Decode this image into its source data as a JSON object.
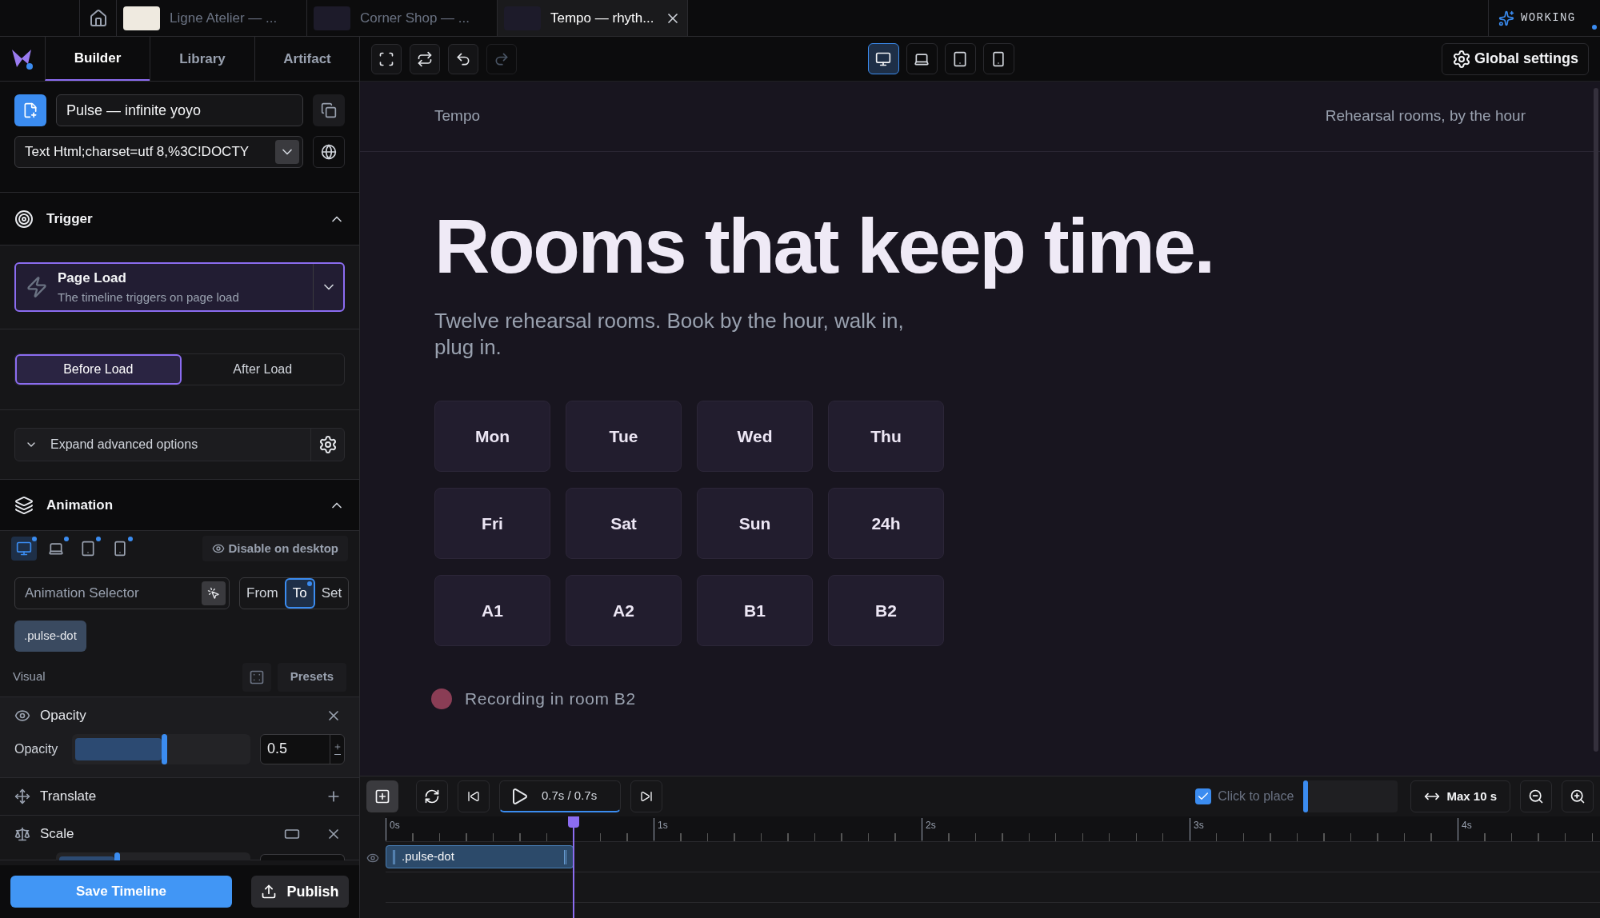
{
  "browser_tabs": [
    {
      "title": "Ligne Atelier — ...",
      "selected": false,
      "color": "#efeae0"
    },
    {
      "title": "Corner Shop — ...",
      "selected": false,
      "color": "#1d1b2a"
    },
    {
      "title": "Tempo — rhyth...",
      "selected": true,
      "color": "#1d1b2a"
    }
  ],
  "status": {
    "label": "WORKING"
  },
  "panel_tabs": [
    {
      "label": "Builder",
      "selected": true
    },
    {
      "label": "Library",
      "selected": false
    },
    {
      "label": "Artifact",
      "selected": false
    }
  ],
  "timeline_name": {
    "value": "Pulse — infinite yoyo"
  },
  "source_url": {
    "value": "Text Html;charset=utf 8,%3C!DOCTY"
  },
  "trigger": {
    "title": "Trigger",
    "expanded": true,
    "event": "Page Load",
    "description": "The timeline triggers on page load",
    "modes": [
      {
        "label": "Before Load",
        "selected": true
      },
      {
        "label": "After Load",
        "selected": false
      }
    ],
    "advanced": "Expand advanced options"
  },
  "animation": {
    "title": "Animation",
    "expanded": true,
    "devices": [
      {
        "kind": "desktop",
        "selected": true
      },
      {
        "kind": "laptop",
        "selected": false
      },
      {
        "kind": "tablet",
        "selected": false
      },
      {
        "kind": "phone",
        "selected": false
      }
    ],
    "disable_label": "Disable on desktop",
    "selector_placeholder": "Animation Selector",
    "directions": [
      {
        "label": "From",
        "selected": false
      },
      {
        "label": "To",
        "selected": true
      },
      {
        "label": "Set",
        "selected": false
      }
    ],
    "selectors": [
      ".pulse-dot"
    ],
    "visual_label": "Visual",
    "presets_label": "Presets",
    "properties": [
      {
        "kind": "slider",
        "title": "Opacity",
        "field_label": "Opacity",
        "level": 0.5,
        "value": "0.5"
      },
      {
        "kind": "header",
        "title": "Translate"
      },
      {
        "kind": "slider",
        "title": "Scale",
        "level": 0.3
      }
    ]
  },
  "actions": {
    "save": "Save Timeline",
    "publish": "Publish"
  },
  "toolbar": {
    "devices": [
      {
        "kind": "desktop",
        "selected": true
      },
      {
        "kind": "laptop",
        "selected": false
      },
      {
        "kind": "tablet",
        "selected": false
      },
      {
        "kind": "phone",
        "selected": false
      }
    ],
    "global_settings": "Global settings"
  },
  "preview": {
    "brand": "Tempo",
    "tagline": "Rehearsal rooms, by the hour",
    "headline": "Rooms that keep time.",
    "subtitle": "Twelve rehearsal rooms. Book by the hour, walk in, plug in.",
    "slots": [
      "Mon",
      "Tue",
      "Wed",
      "Thu",
      "Fri",
      "Sat",
      "Sun",
      "24h",
      "A1",
      "A2",
      "B1",
      "B2"
    ],
    "recording": "Recording in room B2"
  },
  "timeline": {
    "time": "0.7s / 0.7s",
    "click_to_place": {
      "label": "Click to place",
      "checked": true
    },
    "max": "Max 10 s",
    "ruler": [
      "0s",
      "1s",
      "2s",
      "3s",
      "4s"
    ],
    "tracks": [
      {
        "label": ".pulse-dot"
      }
    ]
  }
}
